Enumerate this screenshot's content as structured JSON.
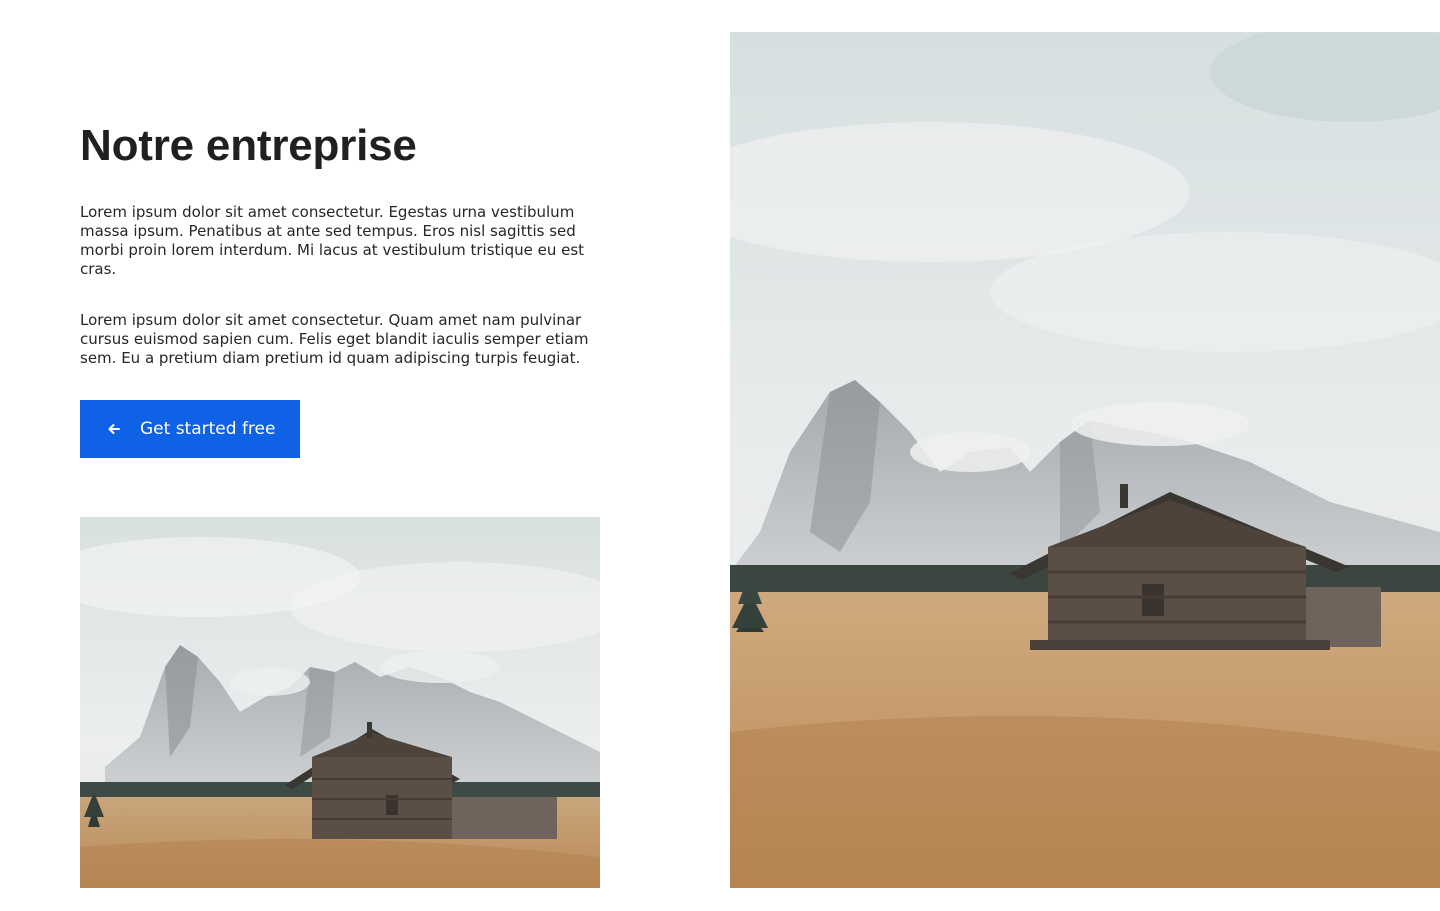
{
  "section": {
    "title": "Notre entreprise",
    "paragraphs": [
      "Lorem ipsum dolor sit amet consectetur. Egestas urna vestibulum massa ipsum. Penatibus at ante sed tempus. Eros nisl sagittis sed morbi proin lorem interdum. Mi lacus at vestibulum tristique eu est cras.",
      "Lorem ipsum dolor sit amet consectetur. Quam amet nam pulvinar cursus euismod sapien cum. Felis eget blandit iaculis semper etiam sem. Eu a pretium diam pretium id quam adipiscing turpis feugiat."
    ],
    "cta": {
      "label": "Get started free",
      "icon": "arrow-left-icon"
    }
  },
  "images": {
    "small": {
      "icon": "landscape-cabin-photo"
    },
    "large": {
      "icon": "landscape-cabin-photo"
    }
  },
  "colors": {
    "accent": "#0f62e6",
    "heading": "#202020",
    "text": "#262626",
    "background": "#ffffff"
  }
}
